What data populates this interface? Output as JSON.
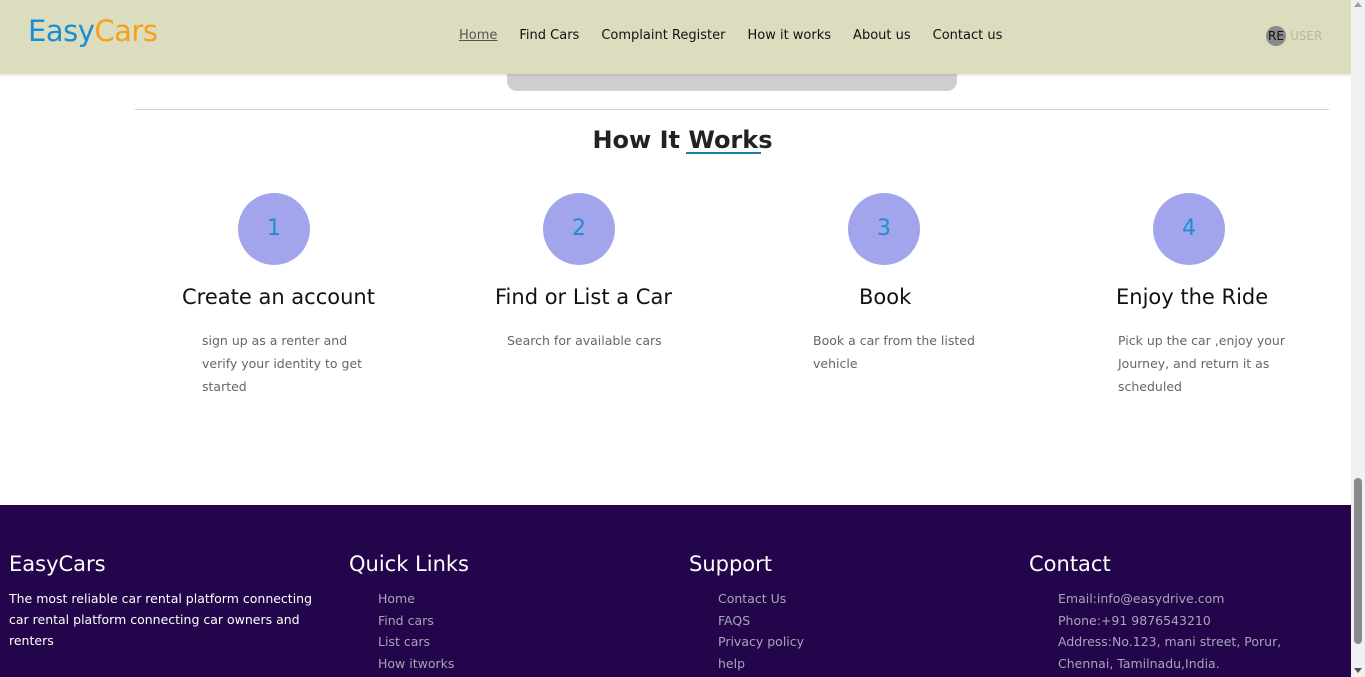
{
  "header": {
    "logo_part1": "Easy",
    "logo_part2": "Cars",
    "nav": [
      "Home",
      "Find Cars",
      "Complaint Register",
      "How it works",
      "About us",
      "Contact us"
    ],
    "user_avatar": "RE",
    "user_label": "USER"
  },
  "how_it_works": {
    "title": "How It Works",
    "steps": [
      {
        "number": "1",
        "title": "Create an account",
        "desc": "sign up as a renter and verify your identity to get started"
      },
      {
        "number": "2",
        "title": "Find or List a Car",
        "desc": "Search for available cars"
      },
      {
        "number": "3",
        "title": "Book",
        "desc": "Book a car from the listed vehicle"
      },
      {
        "number": "4",
        "title": "Enjoy the Ride",
        "desc": "Pick up the car ,enjoy your Journey, and return it as scheduled"
      }
    ]
  },
  "footer": {
    "brand": {
      "title": "EasyCars",
      "text": "The most reliable car rental platform connecting car rental platform connecting car owners and renters"
    },
    "quick_links": {
      "title": "Quick Links",
      "items": [
        "Home",
        "Find cars",
        "List cars",
        "How itworks"
      ]
    },
    "support": {
      "title": "Support",
      "items": [
        "Contact Us",
        "FAQS",
        "Privacy policy",
        "help"
      ]
    },
    "contact": {
      "title": "Contact",
      "items": [
        "Email:info@easydrive.com",
        "Phone:+91 9876543210",
        "Address:No.123, mani street, Porur, Chennai, Tamilnadu,India."
      ]
    }
  },
  "colors": {
    "header_bg": "#dcdcbf",
    "logo_easy": "#1a8fd0",
    "logo_cars": "#f5a21a",
    "step_circle": "#a3a5ec",
    "footer_bg": "#22054a"
  }
}
